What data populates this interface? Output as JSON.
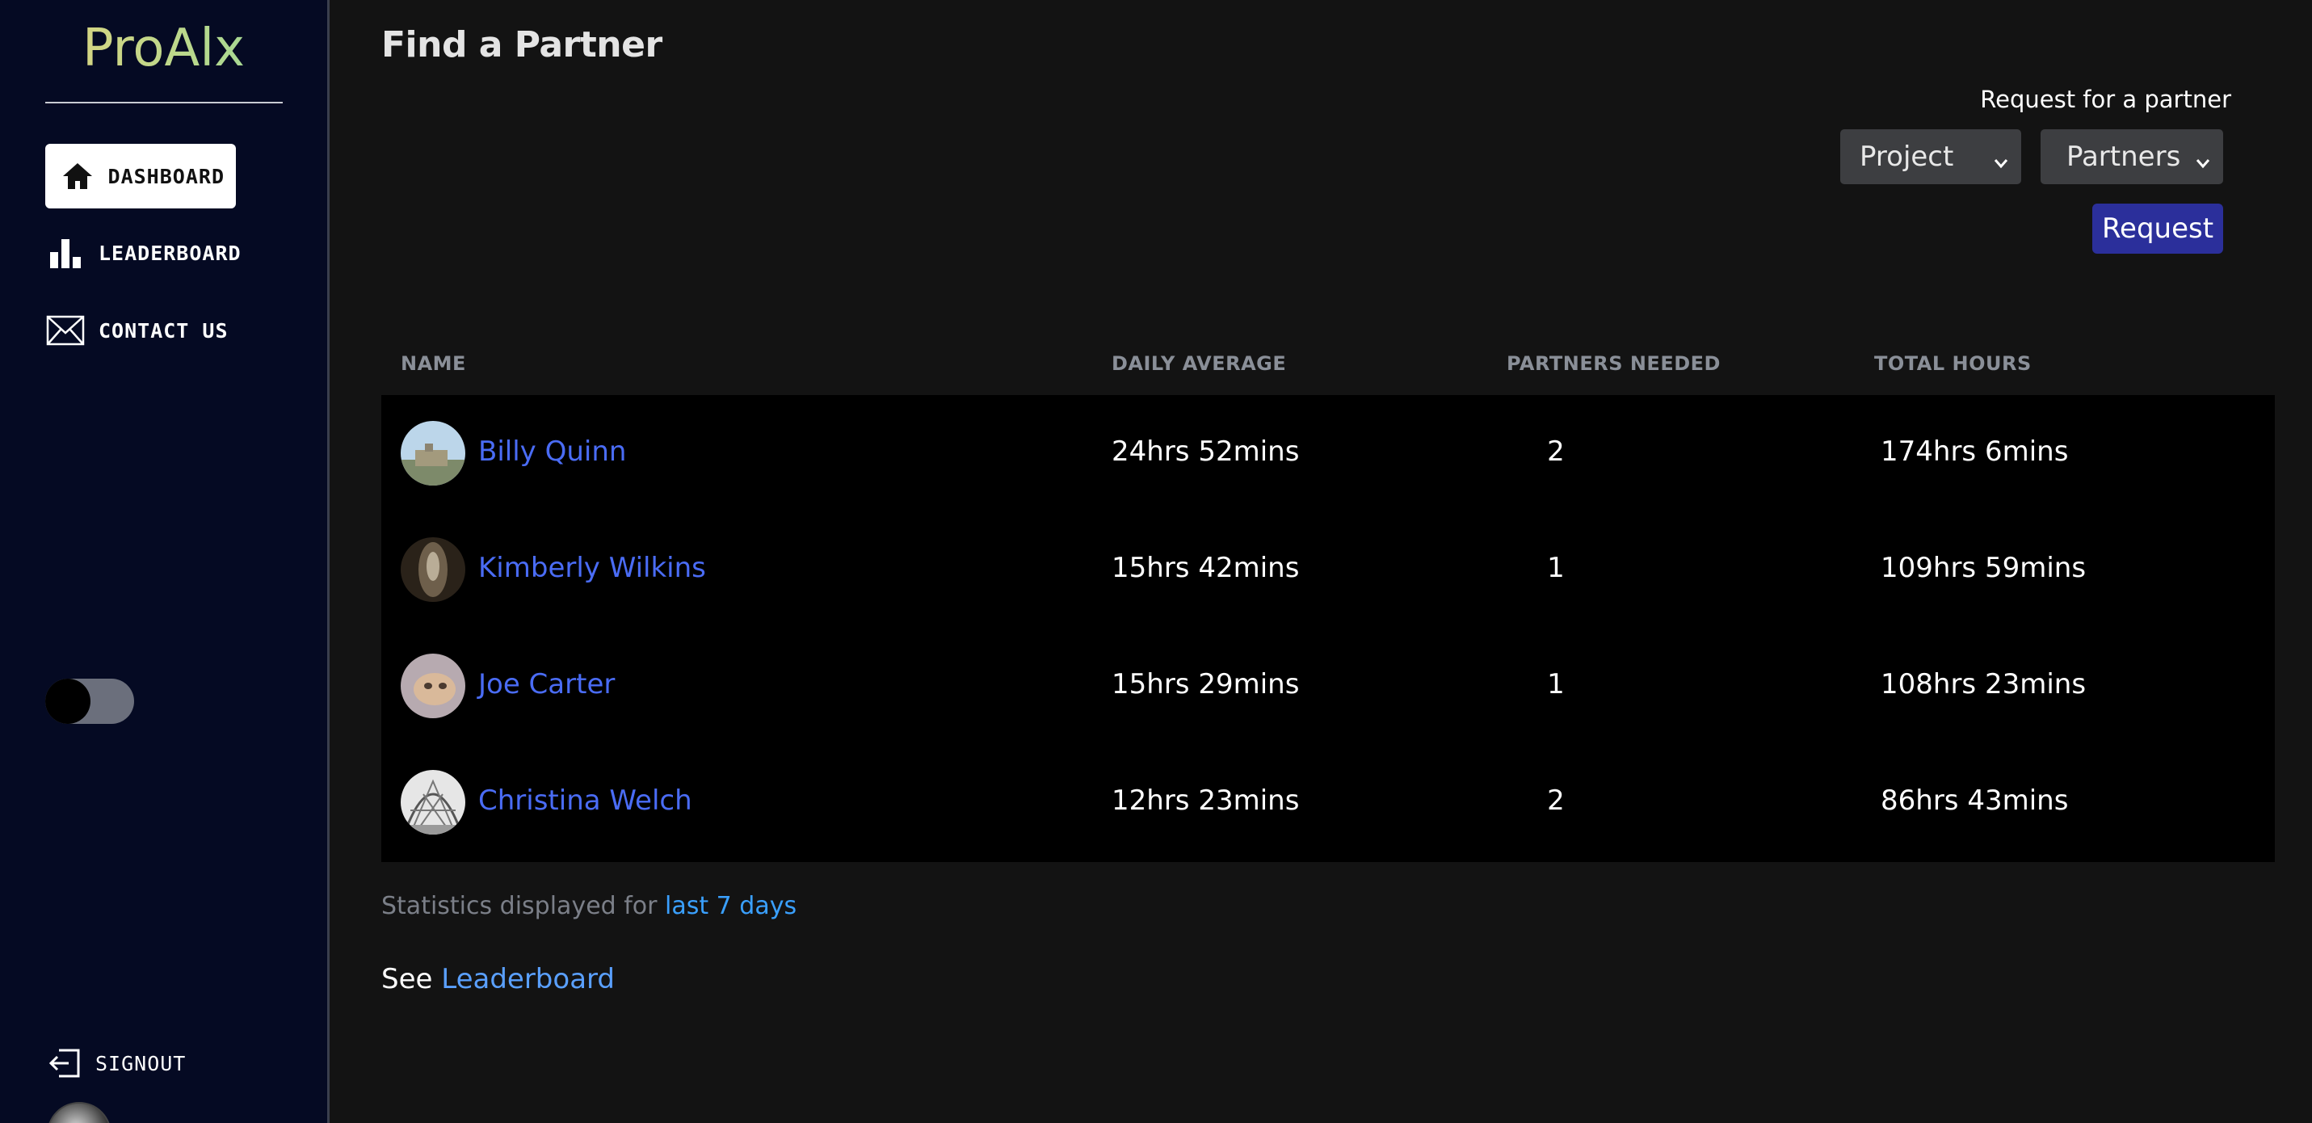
{
  "app": {
    "logo": "ProAlx"
  },
  "sidebar": {
    "items": [
      {
        "label": "DASHBOARD",
        "icon": "home-icon",
        "active": true
      },
      {
        "label": "LEADERBOARD",
        "icon": "bar-chart-icon",
        "active": false
      },
      {
        "label": "CONTACT US",
        "icon": "envelope-icon",
        "active": false
      }
    ],
    "theme_toggle": {
      "state": "off"
    },
    "signout_label": "SIGNOUT"
  },
  "main": {
    "title": "Find a Partner",
    "request": {
      "label": "Request for a partner",
      "project_select": "Project",
      "partners_select": "Partners",
      "button": "Request"
    },
    "table": {
      "headers": [
        "NAME",
        "DAILY AVERAGE",
        "PARTNERS NEEDED",
        "TOTAL HOURS"
      ],
      "rows": [
        {
          "name": "Billy Quinn",
          "daily_average": "24hrs 52mins",
          "partners_needed": "2",
          "total_hours": "174hrs 6mins"
        },
        {
          "name": "Kimberly Wilkins",
          "daily_average": "15hrs 42mins",
          "partners_needed": "1",
          "total_hours": "109hrs 59mins"
        },
        {
          "name": "Joe Carter",
          "daily_average": "15hrs 29mins",
          "partners_needed": "1",
          "total_hours": "108hrs 23mins"
        },
        {
          "name": "Christina Welch",
          "daily_average": "12hrs 23mins",
          "partners_needed": "2",
          "total_hours": "86hrs 43mins"
        }
      ]
    },
    "stats_note": {
      "prefix": "Statistics displayed for ",
      "link": "last 7 days"
    },
    "see_line": {
      "prefix": "See ",
      "link": "Leaderboard"
    }
  },
  "colors": {
    "sidebar_bg": "#050a23",
    "main_bg": "#131313",
    "link_blue": "#4a6cf5",
    "button_bg": "#2b2f9b"
  }
}
